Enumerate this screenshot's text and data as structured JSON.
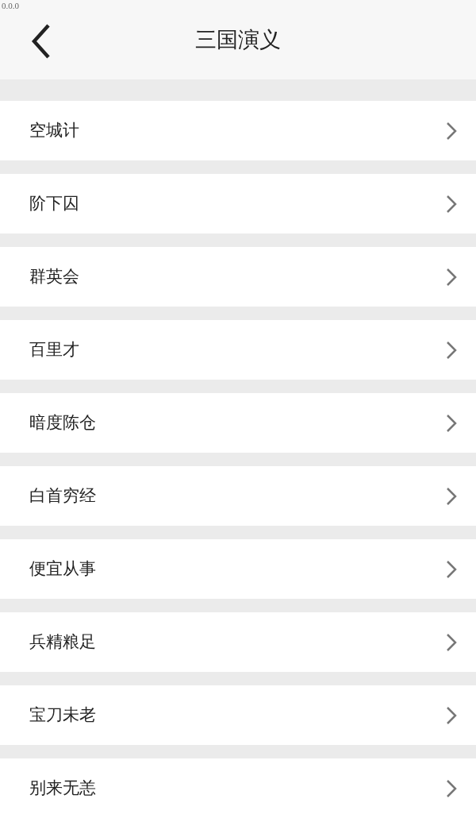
{
  "version": "0.0.0",
  "header": {
    "title": "三国演义"
  },
  "items": [
    {
      "label": "空城计"
    },
    {
      "label": "阶下囚"
    },
    {
      "label": "群英会"
    },
    {
      "label": "百里才"
    },
    {
      "label": "暗度陈仓"
    },
    {
      "label": "白首穷经"
    },
    {
      "label": "便宜从事"
    },
    {
      "label": "兵精粮足"
    },
    {
      "label": "宝刀未老"
    },
    {
      "label": "别来无恙"
    }
  ]
}
